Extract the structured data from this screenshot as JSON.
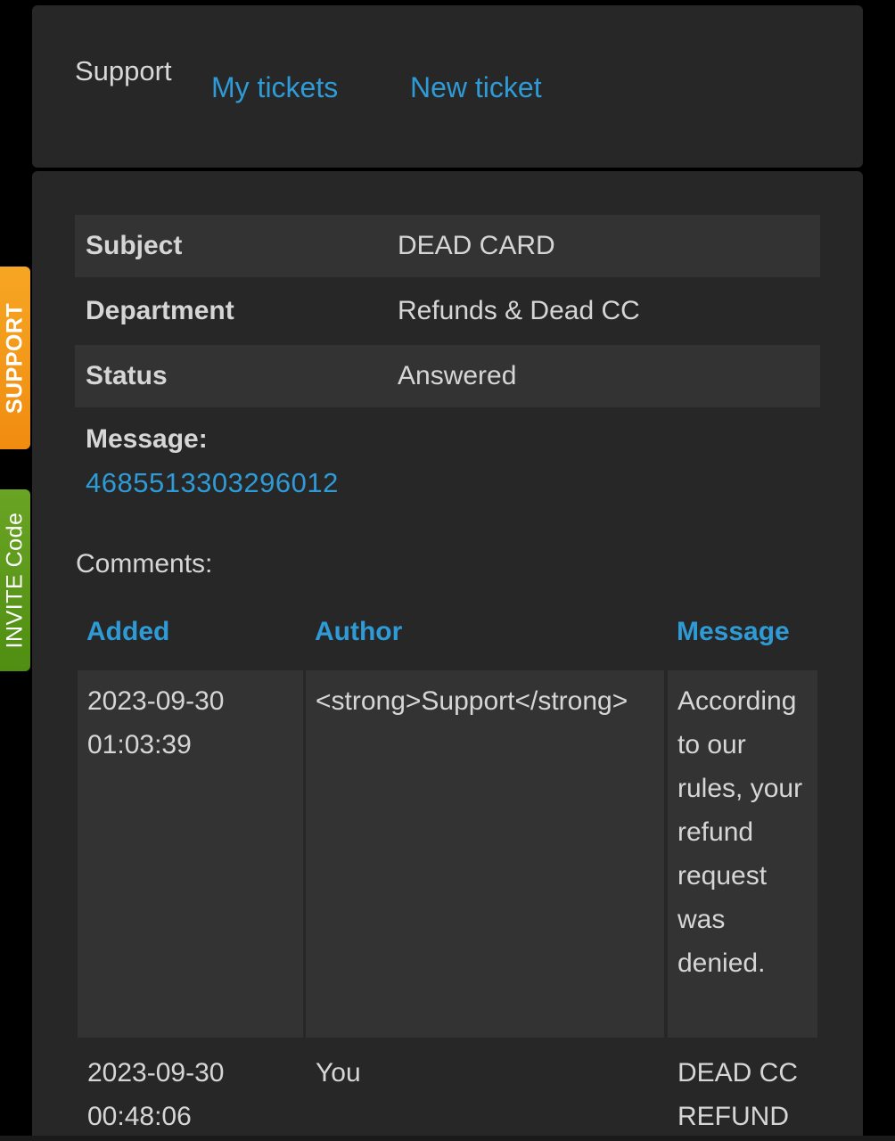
{
  "nav": {
    "brand": "Support",
    "links": [
      "My tickets",
      "New ticket"
    ]
  },
  "ticket": {
    "fields": [
      {
        "label": "Subject",
        "value": "DEAD CARD"
      },
      {
        "label": "Department",
        "value": "Refunds & Dead CC"
      },
      {
        "label": "Status",
        "value": "Answered"
      }
    ],
    "message_label": "Message:",
    "message_value": "4685513303296012"
  },
  "comments": {
    "label": "Comments:",
    "headers": [
      "Added",
      "Author",
      "Message"
    ],
    "rows": [
      {
        "added": "2023-09-30 01:03:39",
        "author": "<strong>Support</strong>",
        "message": "According to our rules, your refund request was denied."
      },
      {
        "added": "2023-09-30 00:48:06",
        "author": "You",
        "message": "DEAD CC REFUND"
      }
    ]
  },
  "side_tabs": {
    "support": "SUPPORT",
    "invite": "INVITE Code"
  },
  "colors": {
    "link": "#2f9bd6",
    "panel": "#272727",
    "row_shade": "#333333",
    "support_tab": "#f39a19",
    "invite_tab": "#5c9a1b"
  }
}
